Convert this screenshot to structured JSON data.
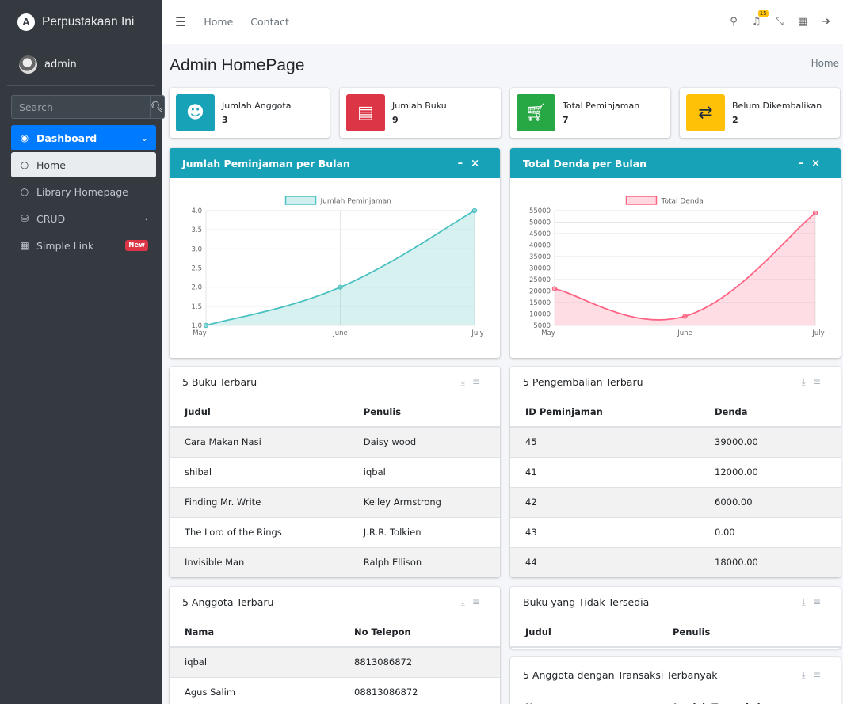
{
  "brand": {
    "title": "Perpustakaan Ini"
  },
  "user": {
    "name": "admin"
  },
  "search": {
    "placeholder": "Search"
  },
  "sidebar": {
    "items": [
      {
        "label": "Dashboard"
      },
      {
        "label": "Home"
      },
      {
        "label": "Library Homepage"
      },
      {
        "label": "CRUD"
      },
      {
        "label": "Simple Link",
        "badge": "New"
      }
    ]
  },
  "topnav": {
    "home": "Home",
    "contact": "Contact",
    "notifications_count": "15"
  },
  "page": {
    "title": "Admin HomePage",
    "breadcrumb": "Home"
  },
  "info_boxes": [
    {
      "label": "Jumlah Anggota",
      "value": "3",
      "color": "#17a2b8"
    },
    {
      "label": "Jumlah Buku",
      "value": "9",
      "color": "#dc3545"
    },
    {
      "label": "Total Peminjaman",
      "value": "7",
      "color": "#28a745"
    },
    {
      "label": "Belum Dikembalikan",
      "value": "2",
      "color": "#ffc107"
    }
  ],
  "chart_titles": {
    "loans": "Jumlah Peminjaman per Bulan",
    "fines": "Total Denda per Bulan"
  },
  "chart_data": [
    {
      "type": "area",
      "categories": [
        "May",
        "June",
        "July"
      ],
      "series": [
        {
          "name": "Jumlah Peminjaman",
          "values": [
            1,
            2,
            4
          ]
        }
      ],
      "ylim": [
        1.0,
        4.0
      ],
      "yticks": [
        "1.0",
        "1.5",
        "2.0",
        "2.5",
        "3.0",
        "3.5",
        "4.0"
      ],
      "color": "#4bc0c0"
    },
    {
      "type": "area",
      "categories": [
        "May",
        "June",
        "July"
      ],
      "series": [
        {
          "name": "Total Denda",
          "values": [
            21000,
            9000,
            54000
          ]
        }
      ],
      "ylim": [
        5000,
        55000
      ],
      "yticks": [
        "5000",
        "10000",
        "15000",
        "20000",
        "25000",
        "30000",
        "35000",
        "40000",
        "45000",
        "50000",
        "55000"
      ],
      "color": "#ff6384"
    }
  ],
  "books": {
    "title": "5 Buku Terbaru",
    "headers": [
      "Judul",
      "Penulis"
    ],
    "rows": [
      [
        "Cara Makan Nasi",
        "Daisy wood"
      ],
      [
        "shibal",
        "iqbal"
      ],
      [
        "Finding Mr. Write",
        "Kelley Armstrong"
      ],
      [
        "The Lord of the Rings",
        "J.R.R. Tolkien"
      ],
      [
        "Invisible Man",
        "Ralph Ellison"
      ]
    ]
  },
  "returns": {
    "title": "5 Pengembalian Terbaru",
    "headers": [
      "ID Peminjaman",
      "Denda"
    ],
    "rows": [
      [
        "45",
        "39000.00"
      ],
      [
        "41",
        "12000.00"
      ],
      [
        "42",
        "6000.00"
      ],
      [
        "43",
        "0.00"
      ],
      [
        "44",
        "18000.00"
      ]
    ]
  },
  "members": {
    "title": "5 Anggota Terbaru",
    "headers": [
      "Nama",
      "No Telepon"
    ],
    "rows": [
      [
        "iqbal",
        "8813086872"
      ],
      [
        "Agus Salim",
        "08813086872"
      ]
    ]
  },
  "unavailable": {
    "title": "Buku yang Tidak Tersedia",
    "headers": [
      "Judul",
      "Penulis"
    ]
  },
  "top_members": {
    "title": "5 Anggota dengan Transaksi Terbanyak",
    "headers": [
      "Nama",
      "Jumlah Transaksi"
    ]
  }
}
